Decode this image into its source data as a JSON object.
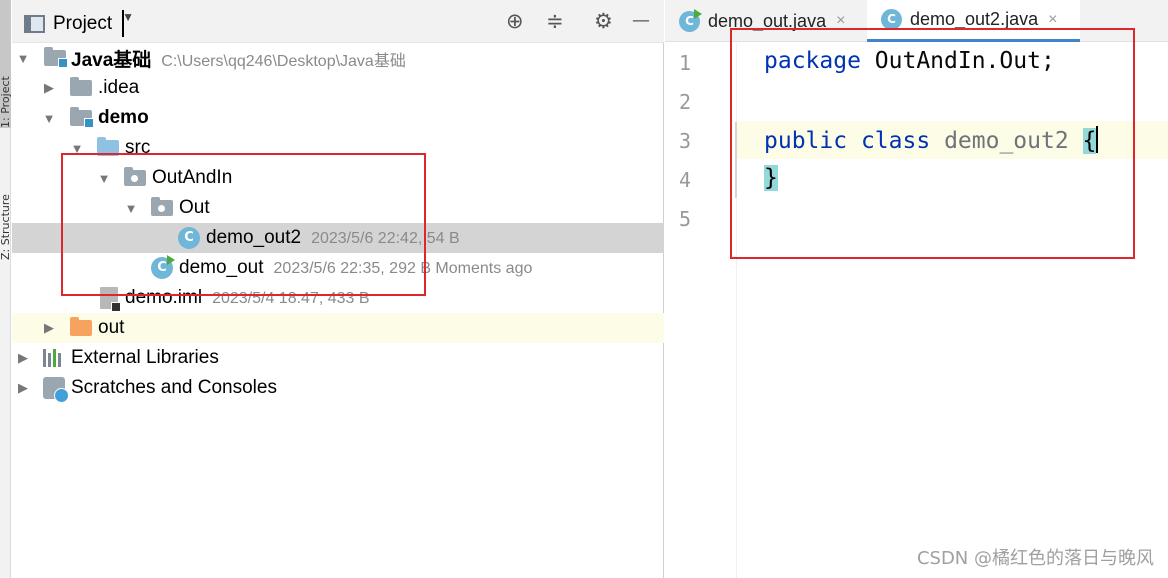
{
  "side_strip": {
    "project_tab": "1: Project",
    "structure_tab": "Z: Structure"
  },
  "panel": {
    "title": "Project",
    "icons": [
      "panel-icon",
      "chevron-down-icon",
      "locate-icon",
      "collapse-icon",
      "gear-icon",
      "minimize-icon"
    ],
    "header_glyphs": {
      "locate": "⊕",
      "collapse": "≑",
      "gear": "⚙",
      "minimize": "—"
    }
  },
  "tree": [
    {
      "label": "Java基础",
      "bold": true,
      "meta": "C:\\Users\\qq246\\Desktop\\Java基础",
      "icon": "module-folder-icon"
    },
    {
      "label": ".idea",
      "icon": "folder-icon"
    },
    {
      "label": "demo",
      "bold": true,
      "icon": "module-folder-icon"
    },
    {
      "label": "src",
      "icon": "source-folder-icon"
    },
    {
      "label": "OutAndIn",
      "icon": "package-icon"
    },
    {
      "label": "Out",
      "icon": "package-icon"
    },
    {
      "label": "demo_out2",
      "meta": "2023/5/6 22:42, 54 B",
      "icon": "java-class-icon"
    },
    {
      "label": "demo_out",
      "meta": "2023/5/6 22:35, 292 B Moments ago",
      "icon": "java-class-runnable-icon"
    },
    {
      "label": "demo.iml",
      "meta": "2023/5/4 18:47, 433 B",
      "icon": "iml-file-icon"
    },
    {
      "label": "out",
      "icon": "excluded-folder-icon"
    },
    {
      "label": "External Libraries",
      "icon": "libraries-icon"
    },
    {
      "label": "Scratches and Consoles",
      "icon": "scratches-icon"
    }
  ],
  "editor": {
    "tabs": [
      {
        "label": "demo_out.java",
        "active": false
      },
      {
        "label": "demo_out2.java",
        "active": true
      }
    ],
    "tab_close": "×",
    "line_numbers": [
      "1",
      "2",
      "3",
      "4",
      "5"
    ],
    "code": {
      "line1_kw": "package",
      "line1_rest": " OutAndIn.Out;",
      "line3_kw1": "public",
      "line3_kw2": "class",
      "line3_name": "demo_out2",
      "line3_brace": "{",
      "line4_brace": "}"
    }
  },
  "class_glyph": "C",
  "watermark": "CSDN @橘红色的落日与晚风",
  "colors": {
    "highlight_box": "#e0252b",
    "selection": "#d4d4d4",
    "keyword": "#0033b3",
    "brace_match": "#93d9d9",
    "current_line": "#fdfce6"
  }
}
